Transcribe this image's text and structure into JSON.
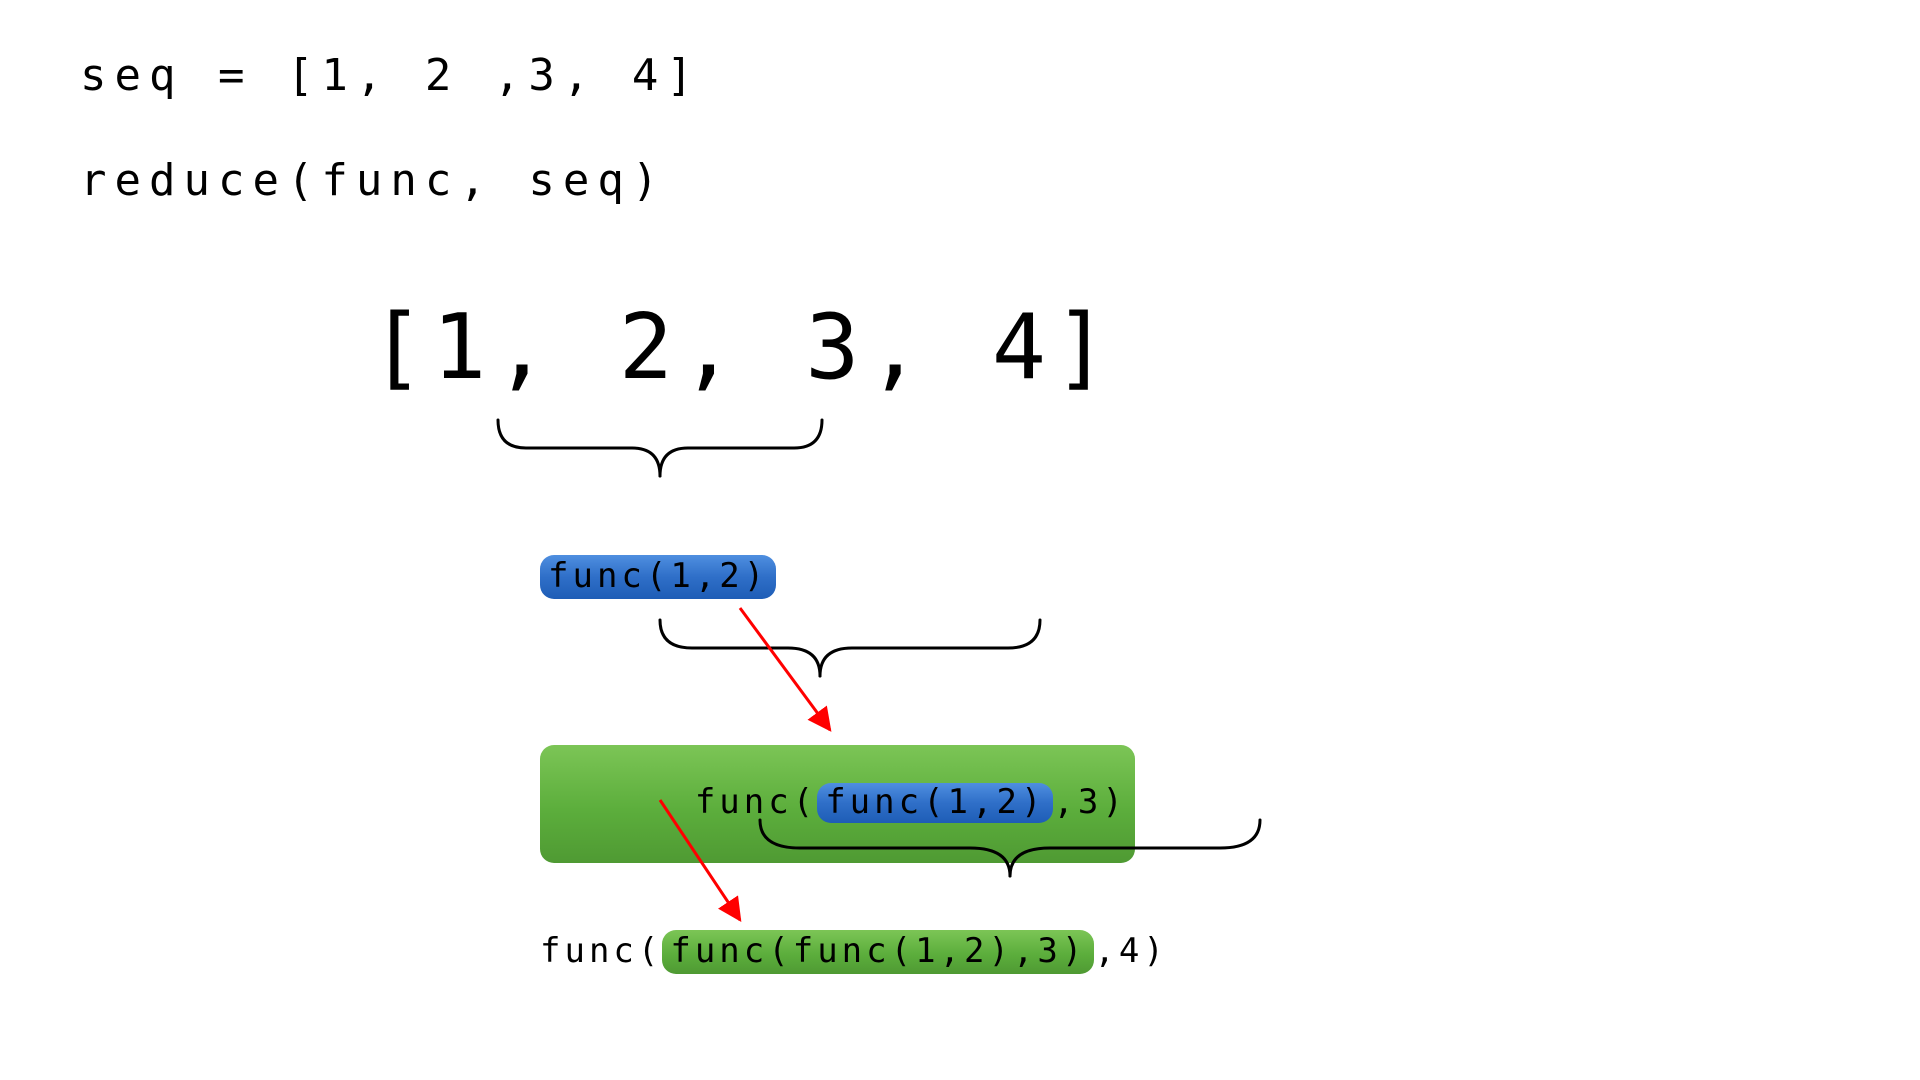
{
  "code": {
    "line1": "seq = [1, 2 ,3, 4]",
    "line2": "reduce(func, seq)"
  },
  "sequence_display": "[1, 2, 3, 4]",
  "steps": {
    "s1": {
      "inner": "func(1,2)"
    },
    "s2": {
      "prefix": "func(",
      "inner": "func(1,2)",
      "suffix": ",3)"
    },
    "s3": {
      "prefix": "func(",
      "inner_prefix": "func(",
      "inner_inner": "func(1,2)",
      "inner_suffix": ",3)",
      "suffix": ",4)"
    }
  },
  "colors": {
    "blue": "#2f6fc8",
    "green": "#5cae3c",
    "arrow": "#ff0000"
  }
}
